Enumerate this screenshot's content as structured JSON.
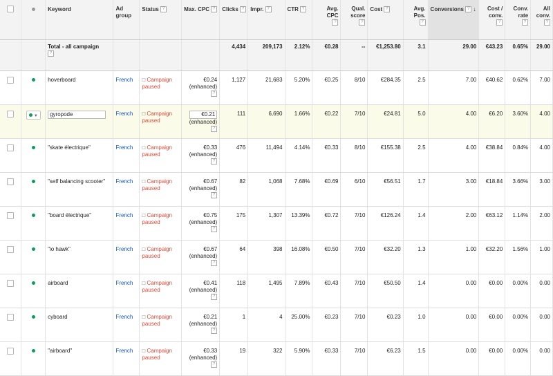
{
  "headers": {
    "keyword": "Keyword",
    "ad_group": "Ad group",
    "status": "Status",
    "max_cpc": "Max. CPC",
    "clicks": "Clicks",
    "impr": "Impr.",
    "ctr": "CTR",
    "avg_cpc": "Avg. CPC",
    "qual_score": "Qual. score",
    "cost": "Cost",
    "avg_pos": "Avg. Pos.",
    "conversions": "Conversions",
    "cost_conv": "Cost / conv.",
    "conv_rate": "Conv. rate",
    "all_conv": "All conv.",
    "help_mark": "?",
    "sort_indicator": "↓"
  },
  "total": {
    "label": "Total - all campaign",
    "clicks": "4,434",
    "impr": "209,173",
    "ctr": "2.12%",
    "avg_cpc": "€0.28",
    "qual": "--",
    "cost": "€1,253.80",
    "avg_pos": "3.1",
    "conversions": "29.00",
    "cost_conv": "€43.23",
    "conv_rate": "0.65%",
    "all_conv": "29.00"
  },
  "rows": [
    {
      "keyword": "hoverboard",
      "ad_group": "French",
      "status_line1": "Campaign",
      "status_line2": "paused",
      "cpc": "€0.24",
      "cpc_note": "(enhanced)",
      "clicks": "1,127",
      "impr": "21,683",
      "ctr": "5.20%",
      "avg_cpc": "€0.25",
      "qual": "8/10",
      "cost": "€284.35",
      "avg_pos": "2.5",
      "conversions": "7.00",
      "cost_conv": "€40.62",
      "conv_rate": "0.62%",
      "all_conv": "7.00"
    },
    {
      "keyword": "gyropode",
      "ad_group": "French",
      "status_line1": "Campaign",
      "status_line2": "paused",
      "cpc": "€0.21",
      "cpc_note": "(enhanced)",
      "clicks": "111",
      "impr": "6,690",
      "ctr": "1.66%",
      "avg_cpc": "€0.22",
      "qual": "7/10",
      "cost": "€24.81",
      "avg_pos": "5.0",
      "conversions": "4.00",
      "cost_conv": "€6.20",
      "conv_rate": "3.60%",
      "all_conv": "4.00"
    },
    {
      "keyword": "\"skate électrique\"",
      "ad_group": "French",
      "status_line1": "Campaign",
      "status_line2": "paused",
      "cpc": "€0.33",
      "cpc_note": "(enhanced)",
      "clicks": "476",
      "impr": "11,494",
      "ctr": "4.14%",
      "avg_cpc": "€0.33",
      "qual": "8/10",
      "cost": "€155.38",
      "avg_pos": "2.5",
      "conversions": "4.00",
      "cost_conv": "€38.84",
      "conv_rate": "0.84%",
      "all_conv": "4.00"
    },
    {
      "keyword": "\"self balancing scooter\"",
      "ad_group": "French",
      "status_line1": "Campaign",
      "status_line2": "paused",
      "cpc": "€0.67",
      "cpc_note": "(enhanced)",
      "clicks": "82",
      "impr": "1,068",
      "ctr": "7.68%",
      "avg_cpc": "€0.69",
      "qual": "6/10",
      "cost": "€56.51",
      "avg_pos": "1.7",
      "conversions": "3.00",
      "cost_conv": "€18.84",
      "conv_rate": "3.66%",
      "all_conv": "3.00"
    },
    {
      "keyword": "\"board électrique\"",
      "ad_group": "French",
      "status_line1": "Campaign",
      "status_line2": "paused",
      "cpc": "€0.75",
      "cpc_note": "(enhanced)",
      "clicks": "175",
      "impr": "1,307",
      "ctr": "13.39%",
      "avg_cpc": "€0.72",
      "qual": "7/10",
      "cost": "€126.24",
      "avg_pos": "1.4",
      "conversions": "2.00",
      "cost_conv": "€63.12",
      "conv_rate": "1.14%",
      "all_conv": "2.00"
    },
    {
      "keyword": "\"io hawk\"",
      "ad_group": "French",
      "status_line1": "Campaign",
      "status_line2": "paused",
      "cpc": "€0.67",
      "cpc_note": "(enhanced)",
      "clicks": "64",
      "impr": "398",
      "ctr": "16.08%",
      "avg_cpc": "€0.50",
      "qual": "7/10",
      "cost": "€32.20",
      "avg_pos": "1.3",
      "conversions": "1.00",
      "cost_conv": "€32.20",
      "conv_rate": "1.56%",
      "all_conv": "1.00"
    },
    {
      "keyword": "airboard",
      "ad_group": "French",
      "status_line1": "Campaign",
      "status_line2": "paused",
      "cpc": "€0.41",
      "cpc_note": "(enhanced)",
      "clicks": "118",
      "impr": "1,495",
      "ctr": "7.89%",
      "avg_cpc": "€0.43",
      "qual": "7/10",
      "cost": "€50.50",
      "avg_pos": "1.4",
      "conversions": "0.00",
      "cost_conv": "€0.00",
      "conv_rate": "0.00%",
      "all_conv": "0.00"
    },
    {
      "keyword": "cyboard",
      "ad_group": "French",
      "status_line1": "Campaign",
      "status_line2": "paused",
      "cpc": "€0.21",
      "cpc_note": "(enhanced)",
      "clicks": "1",
      "impr": "4",
      "ctr": "25.00%",
      "avg_cpc": "€0.23",
      "qual": "7/10",
      "cost": "€0.23",
      "avg_pos": "1.0",
      "conversions": "0.00",
      "cost_conv": "€0.00",
      "conv_rate": "0.00%",
      "all_conv": "0.00"
    },
    {
      "keyword": "\"airboard\"",
      "ad_group": "French",
      "status_line1": "Campaign",
      "status_line2": "paused",
      "cpc": "€0.33",
      "cpc_note": "(enhanced)",
      "clicks": "19",
      "impr": "322",
      "ctr": "5.90%",
      "avg_cpc": "€0.33",
      "qual": "7/10",
      "cost": "€6.23",
      "avg_pos": "1.5",
      "conversions": "0.00",
      "cost_conv": "€0.00",
      "conv_rate": "0.00%",
      "all_conv": "0.00"
    }
  ]
}
